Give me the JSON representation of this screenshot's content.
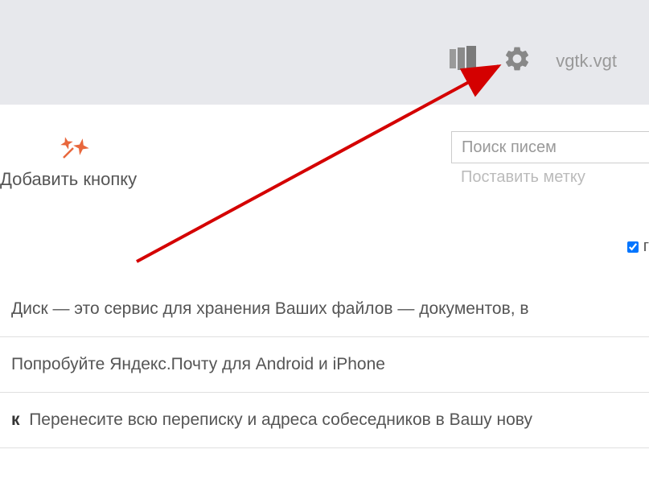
{
  "header": {
    "username": "vgtk.vgt"
  },
  "add_button": {
    "label": "Добавить кнопку"
  },
  "search": {
    "placeholder": "Поиск писем",
    "tag_label": "Поставить метку"
  },
  "checkbox": {
    "label_fragment": "г",
    "checked": true
  },
  "list": {
    "items": [
      {
        "prefix": "",
        "text": "Диск — это сервис для хранения Ваших файлов — документов, в"
      },
      {
        "prefix": "",
        "text": "Попробуйте Яндекс.Почту для Android и iPhone"
      },
      {
        "prefix": "к",
        "text": "Перенесите всю переписку и адреса собеседников в Вашу нову"
      }
    ]
  }
}
